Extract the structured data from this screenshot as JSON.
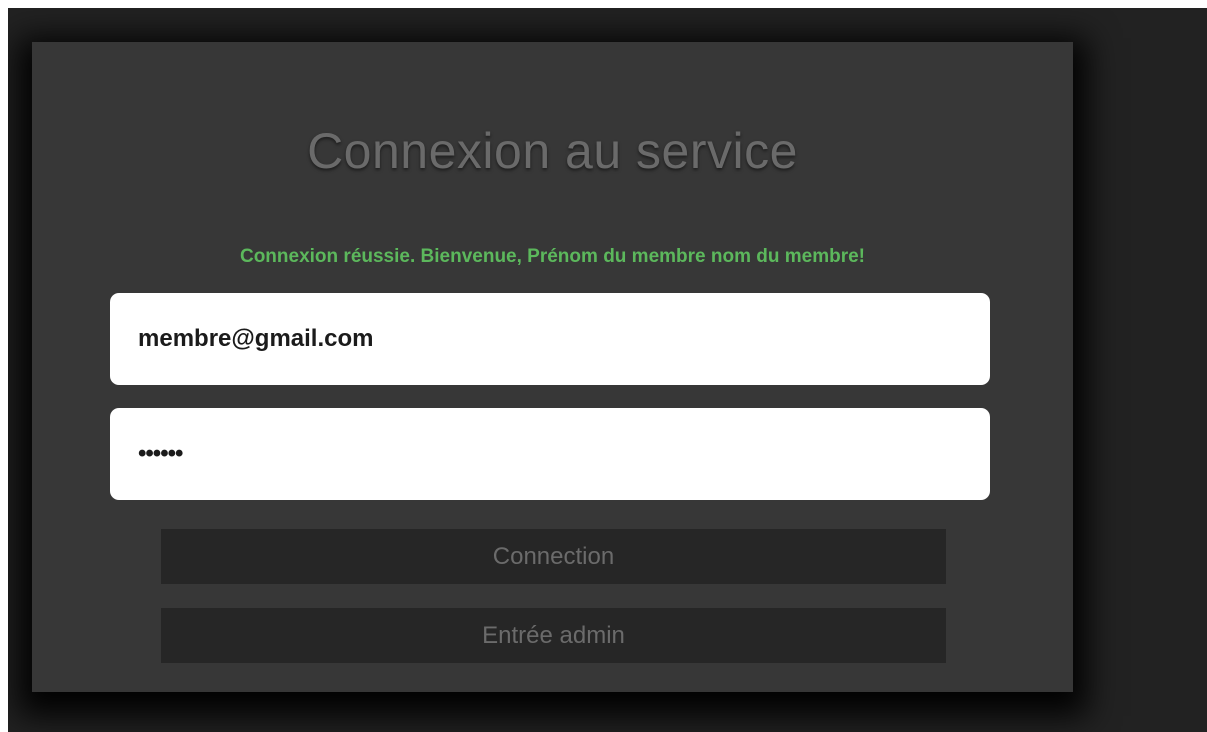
{
  "login": {
    "title": "Connexion au service",
    "status_message": "Connexion réussie. Bienvenue, Prénom du membre nom du membre!",
    "email_value": "membre@gmail.com",
    "password_value": "••••••",
    "connect_label": "Connection",
    "admin_label": "Entrée admin"
  },
  "colors": {
    "page_background": "#222222",
    "panel_background": "#373737",
    "success_text": "#5cb85c",
    "title_text": "#6a6a6a",
    "button_background": "#262626",
    "button_text": "#6b6b6b",
    "input_background": "#ffffff"
  }
}
